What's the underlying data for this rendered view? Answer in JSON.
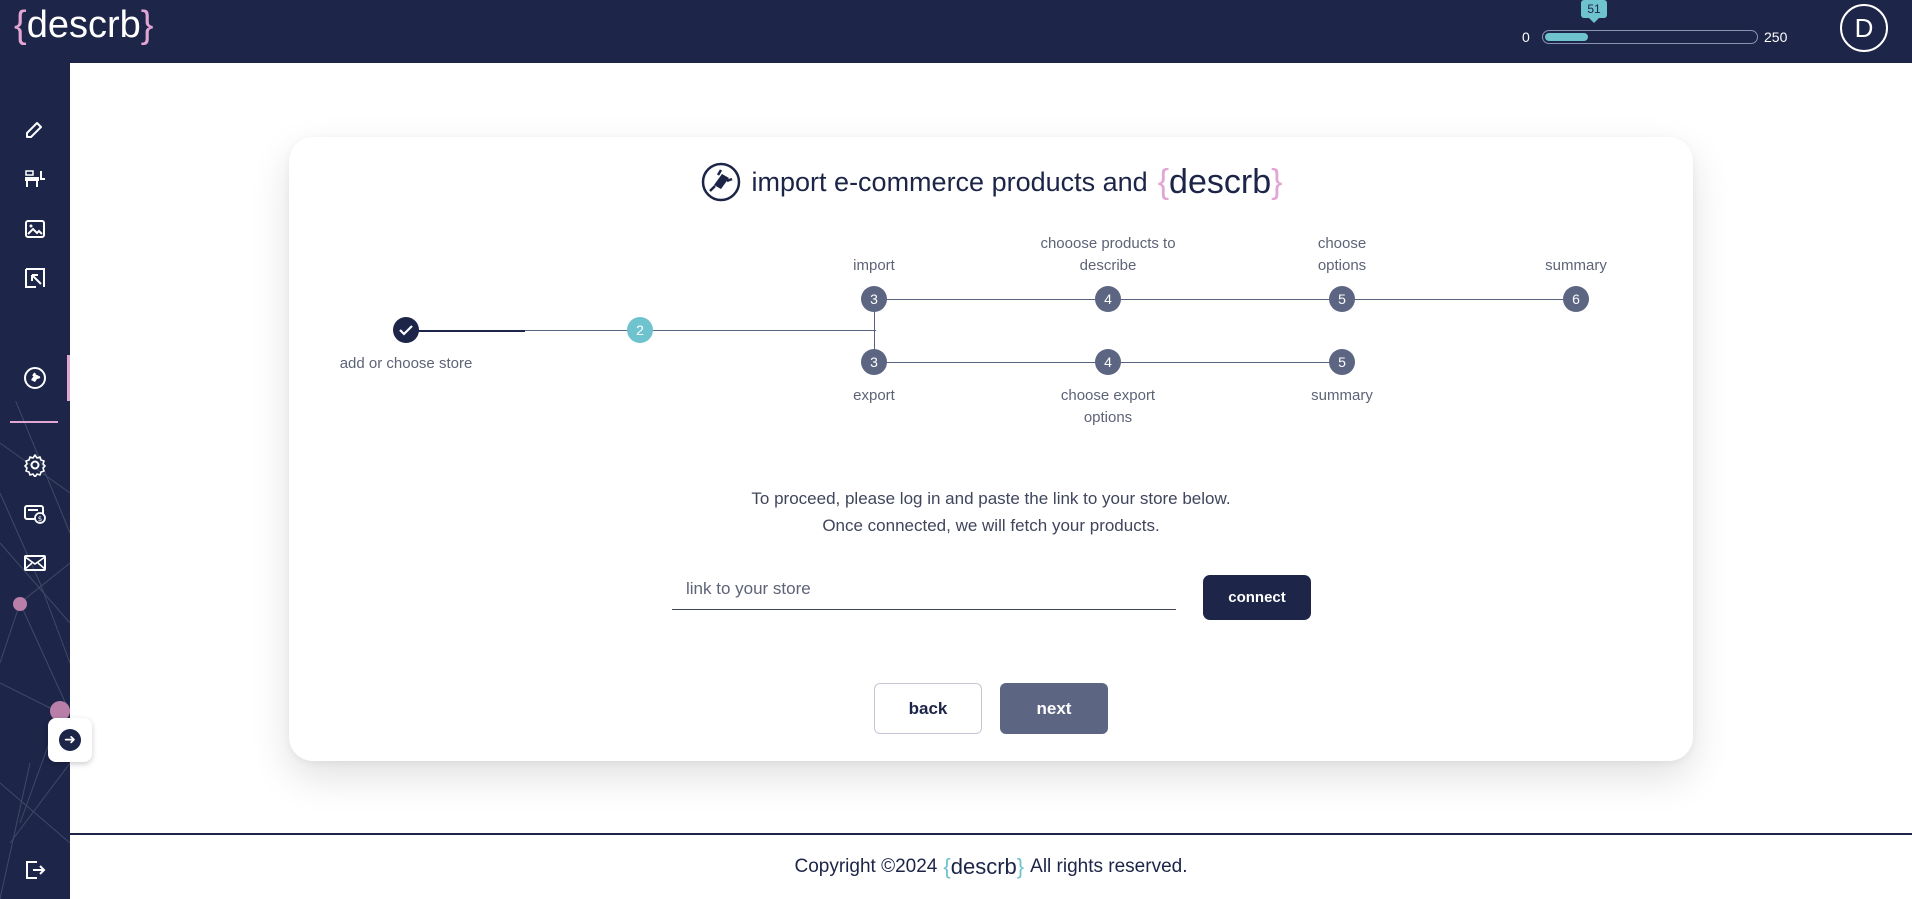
{
  "header": {
    "logo_brace_open": "{",
    "logo_text": "descrb",
    "logo_brace_close": "}",
    "credits_min": "0",
    "credits_max": "250",
    "credits_used": "51",
    "credits_fraction": 0.204,
    "avatar_initial": "D"
  },
  "sidebar": {
    "items": [
      {
        "name": "edit-icon"
      },
      {
        "name": "products-icon"
      },
      {
        "name": "image-icon"
      },
      {
        "name": "export-icon"
      },
      {
        "name": "plug-icon",
        "active": true
      },
      {
        "name": "gear-icon"
      },
      {
        "name": "billing-icon"
      },
      {
        "name": "mail-icon"
      }
    ],
    "expand_icon": "arrow-right-icon",
    "logout_icon": "logout-icon"
  },
  "card": {
    "title": "import e-commerce products and",
    "brand_open": "{",
    "brand_text": "descrb",
    "brand_close": "}",
    "steps": {
      "step1_label": "add or choose store",
      "step2_number": "2",
      "import_number": "3",
      "import_label": "import",
      "import4_number": "4",
      "import4_label": "chooose products to describe",
      "import5_number": "5",
      "import5_label": "choose options",
      "import6_number": "6",
      "import6_label": "summary",
      "export_number": "3",
      "export_label": "export",
      "export4_number": "4",
      "export4_label": "choose export options",
      "export5_number": "5",
      "export5_label": "summary"
    },
    "instruction_line1": "To proceed, please log in and paste the link to your store below.",
    "instruction_line2": "Once connected, we will fetch your products.",
    "store_input_placeholder": "link to your store",
    "store_input_value": "",
    "connect_label": "connect",
    "back_label": "back",
    "next_label": "next"
  },
  "footer": {
    "copyright": "Copyright ©2024",
    "brand_open": "{",
    "brand_text": "descrb",
    "brand_close": "}",
    "rights": "All rights reserved."
  },
  "colors": {
    "navy": "#1d2548",
    "pink": "#e2a6d4",
    "teal": "#6fc3cf",
    "slate": "#5c6582"
  }
}
